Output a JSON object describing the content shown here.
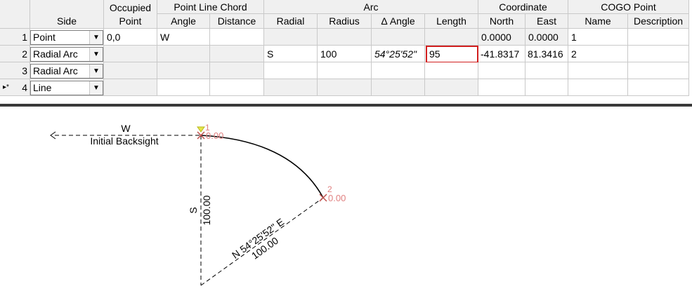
{
  "headers": {
    "side": "Side",
    "occupied_point": "Occupied Point",
    "point_line_chord": "Point Line Chord",
    "angle": "Angle",
    "distance": "Distance",
    "arc": "Arc",
    "radial": "Radial",
    "radius": "Radius",
    "delta_angle": "Δ Angle",
    "length": "Length",
    "coordinate": "Coordinate",
    "north": "North",
    "east": "East",
    "cogo_point": "COGO Point",
    "name": "Name",
    "description": "Description"
  },
  "rows": [
    {
      "num": "1",
      "marker": "",
      "side": "Point",
      "occupied": "0,0",
      "angle": "W",
      "distance": "",
      "radial": "",
      "radius": "",
      "delta": "",
      "length": "",
      "north": "0.0000",
      "east": "0.0000",
      "name": "1",
      "description": ""
    },
    {
      "num": "2",
      "marker": "",
      "side": "Radial Arc",
      "occupied": "",
      "angle": "",
      "distance": "",
      "radial": "S",
      "radius": "100",
      "delta": "54°25'52\"",
      "length": "95",
      "north": "-41.8317",
      "east": "81.3416",
      "name": "2",
      "description": ""
    },
    {
      "num": "3",
      "marker": "",
      "side": "Radial Arc",
      "occupied": "",
      "angle": "",
      "distance": "",
      "radial": "",
      "radius": "",
      "delta": "",
      "length": "",
      "north": "",
      "east": "",
      "name": "",
      "description": ""
    },
    {
      "num": "4",
      "marker": "▸*",
      "side": "Line",
      "occupied": "",
      "angle": "",
      "distance": "",
      "radial": "",
      "radius": "",
      "delta": "",
      "length": "",
      "north": "",
      "east": "",
      "name": "",
      "description": ""
    }
  ],
  "drawing": {
    "backsight_dir": "W",
    "backsight_label": "Initial Backsight",
    "radial_dir": "S",
    "radial_dist": "100.00",
    "chord_bearing": "N 54°25'52\" E",
    "chord_dist": "100.00",
    "point1_num": "1",
    "point1_elev": "0.00",
    "point2_num": "2",
    "point2_elev": "0.00"
  },
  "colors": {
    "point_marker": "#c0504d",
    "point_text": "#e08080",
    "highlight_border": "#d11f1f",
    "splitter": "#3a3a3a",
    "backsight_marker": "#e6e64a"
  }
}
